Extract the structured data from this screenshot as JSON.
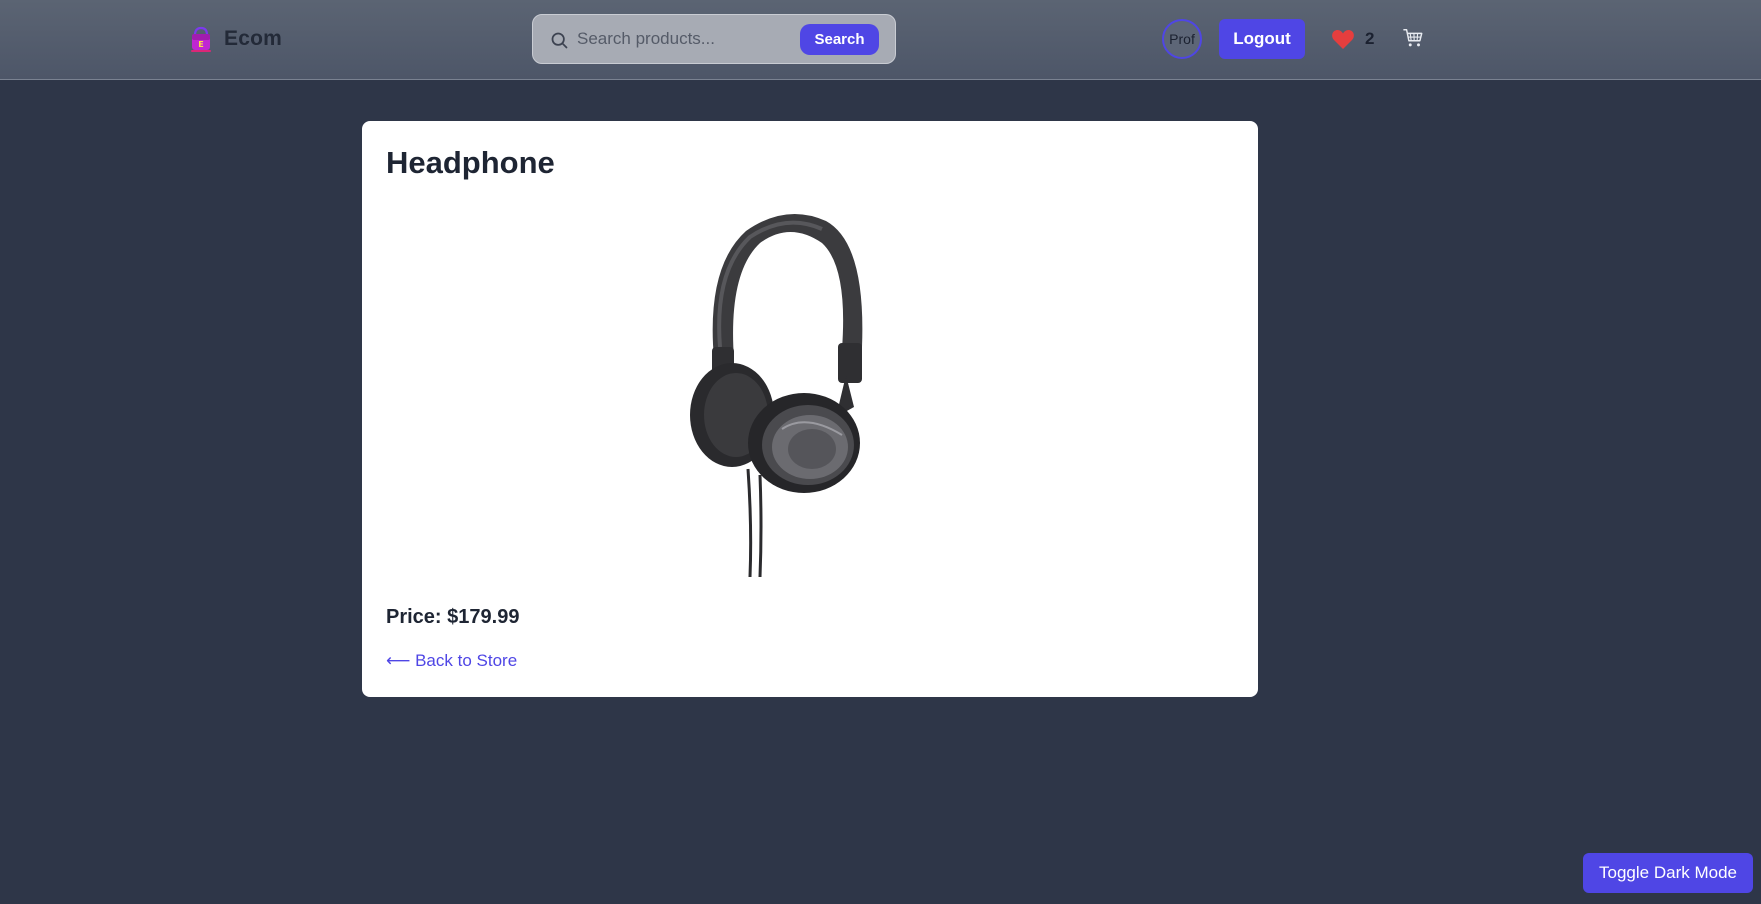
{
  "header": {
    "brand_name": "Ecom",
    "search": {
      "placeholder": "Search products...",
      "value": "",
      "button_label": "Search"
    },
    "avatar_alt": "Profile",
    "avatar_visible_text": "Prof",
    "logout_label": "Logout",
    "wishlist_count": "2",
    "icons": {
      "search": "search-icon",
      "heart": "heart-icon",
      "cart": "cart-icon",
      "logo": "shopping-bag-logo"
    }
  },
  "product": {
    "title": "Headphone",
    "image_alt": "Headphone",
    "price_text": "Price: $179.99",
    "back_link_label": "⟵ Back to Store"
  },
  "footer": {
    "toggle_label": "Toggle Dark Mode"
  },
  "colors": {
    "page_bg": "#2e3648",
    "header_bg": "#525b6b",
    "accent": "#4f46e5",
    "card_bg": "#ffffff",
    "heart": "#e53e3e"
  }
}
